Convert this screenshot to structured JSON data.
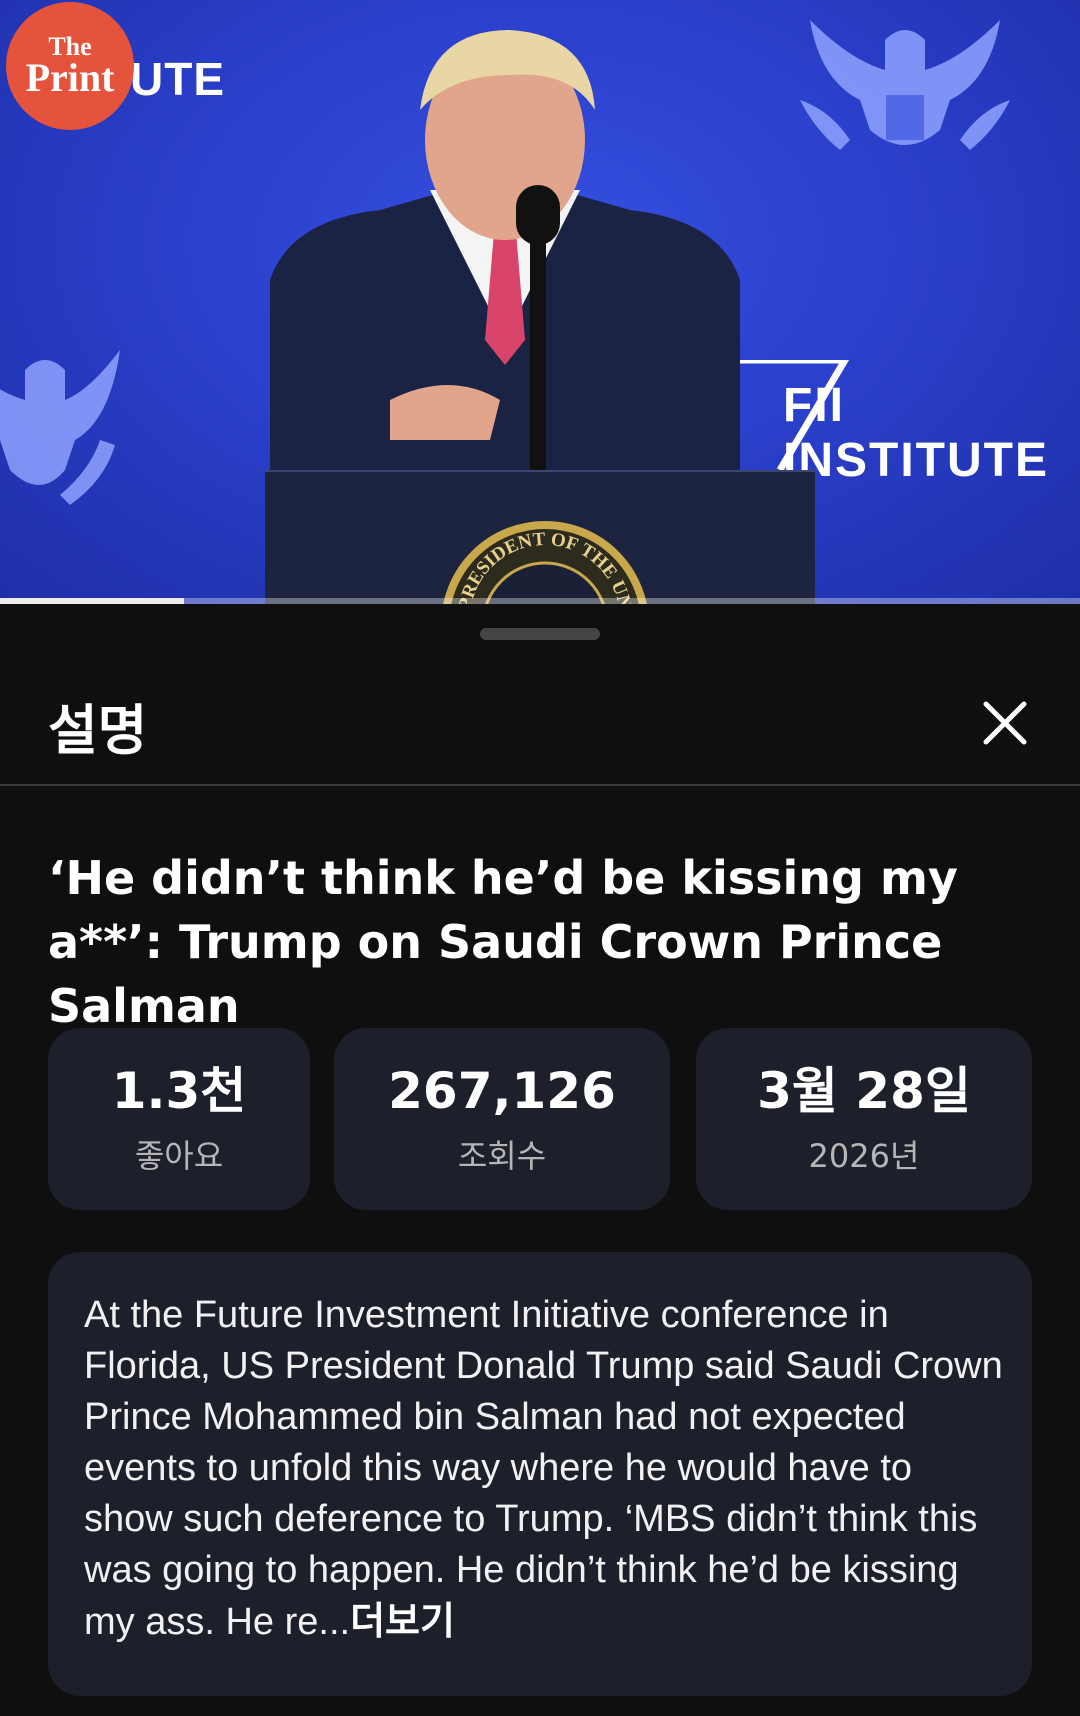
{
  "video": {
    "channel_logo": {
      "line1": "The",
      "line2": "Print"
    },
    "backdrop_text_left": "UTE",
    "backdrop_text_right": "FII INSTITUTE",
    "seal_text": "PRESIDENT OF THE UNITED",
    "progress": 0.17
  },
  "sheet": {
    "title": "설명",
    "close_icon": "close-icon"
  },
  "video_title": "‘He didn’t think he’d be kissing my a**’: Trump on Saudi Crown Prince Salman",
  "stats": {
    "likes": {
      "value": "1.3천",
      "label": "좋아요"
    },
    "views": {
      "value": "267,126",
      "label": "조회수"
    },
    "date": {
      "value": "3월 28일",
      "label": "2026년"
    }
  },
  "description": {
    "text": "At the Future Investment Initiative conference in Florida, US President Donald Trump said Saudi Crown Prince Mohammed bin Salman had not expected events to unfold this way where he would have to show such deference to Trump. ‘MBS didn’t think this was going to happen. He didn’t think he’d be kissing my ass. He re...",
    "more_label": "더보기"
  },
  "colors": {
    "background": "#0f0f0f",
    "card": "#1d1f2b",
    "video_blue": "#2b40cc",
    "logo_red": "#e5533d"
  }
}
